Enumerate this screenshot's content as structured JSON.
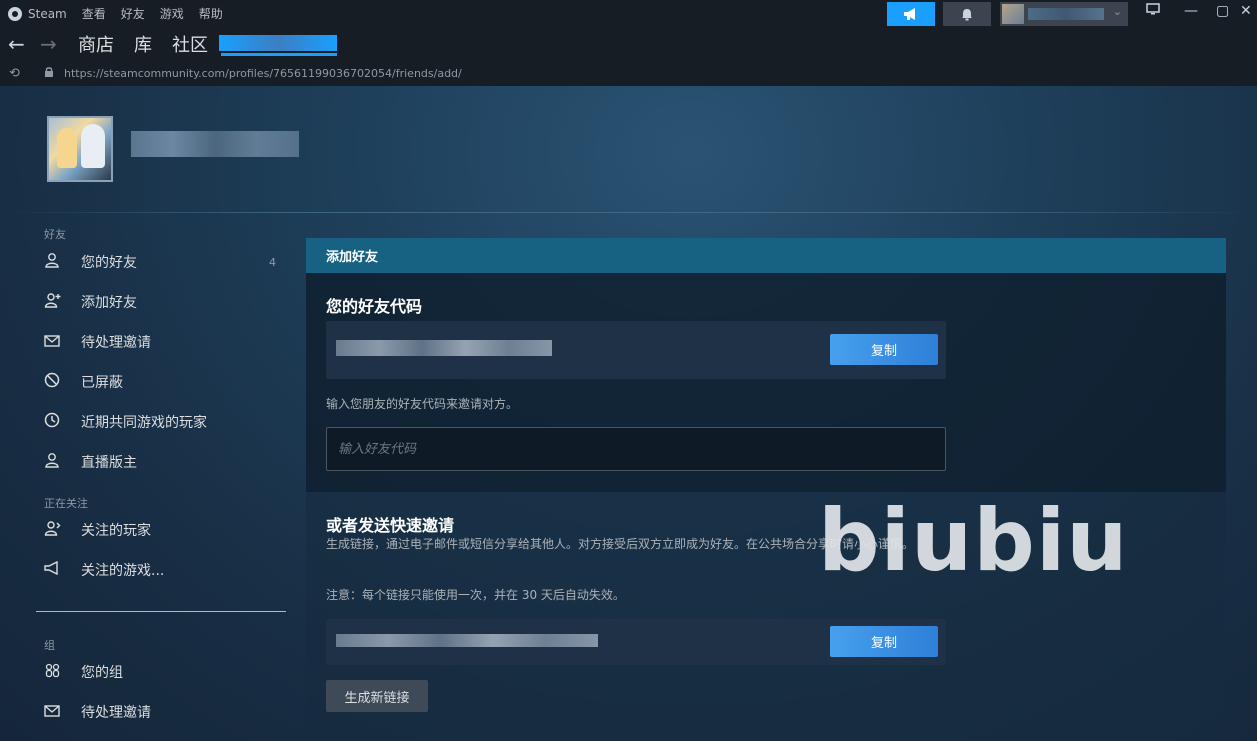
{
  "titlebar": {
    "app_name": "Steam",
    "menu": [
      "查看",
      "好友",
      "游戏",
      "帮助"
    ],
    "icons": {
      "announce": "megaphone-icon",
      "bell": "bell-icon",
      "chevron": "chevron-down-icon"
    },
    "window_controls": {
      "minimize": "—",
      "maximize": "▢",
      "close": "✕"
    },
    "accent": "#1a9fff"
  },
  "navbar": {
    "back": "←",
    "forward": "→",
    "tabs": [
      "商店",
      "库",
      "社区"
    ]
  },
  "urlbar": {
    "url": "https://steamcommunity.com/profiles/76561199036702054/friends/add/"
  },
  "sidebar": {
    "sections": [
      {
        "title": "好友",
        "items": [
          {
            "label": "您的好友",
            "icon": "person-icon",
            "glyph": "♙",
            "count": "4"
          },
          {
            "label": "添加好友",
            "icon": "add-person-icon",
            "glyph": "♙⁺"
          },
          {
            "label": "待处理邀请",
            "icon": "envelope-icon",
            "glyph": "✉"
          },
          {
            "label": "已屏蔽",
            "icon": "blocked-icon",
            "glyph": "⃠"
          },
          {
            "label": "近期共同游戏的玩家",
            "icon": "clock-icon",
            "glyph": "◷"
          },
          {
            "label": "直播版主",
            "icon": "person-icon",
            "glyph": "♙"
          }
        ]
      },
      {
        "title": "正在关注",
        "items": [
          {
            "label": "关注的玩家",
            "icon": "follow-person-icon",
            "glyph": "♙»"
          },
          {
            "label": "关注的游戏...",
            "icon": "megaphone-icon",
            "glyph": "⊲"
          }
        ]
      },
      {
        "title": "组",
        "items": [
          {
            "label": "您的组",
            "icon": "group-icon",
            "glyph": "☃"
          },
          {
            "label": "待处理邀请",
            "icon": "envelope-icon",
            "glyph": "✉"
          }
        ]
      }
    ]
  },
  "panel": {
    "header": "添加好友",
    "friend_code_title": "您的好友代码",
    "copy_label": "复制",
    "enter_code_hint": "输入您朋友的好友代码来邀请对方。",
    "input_placeholder": "输入好友代码",
    "quick_invite_title": "或者发送快速邀请",
    "quick_invite_desc": "生成链接，通过电子邮件或短信分享给其他人。对方接受后双方立即成为好友。在公共场合分享时请小心谨慎。",
    "note": "注意：每个链接只能使用一次，并在 30 天后自动失效。",
    "copy_label_2": "复制",
    "generate_label": "生成新链接"
  },
  "watermark": "biubiu"
}
